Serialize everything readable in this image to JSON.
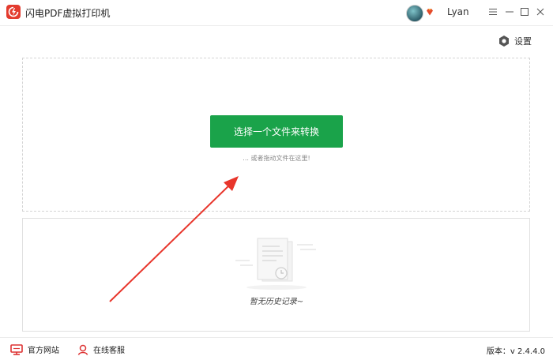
{
  "app": {
    "title": "闪电PDF虚拟打印机"
  },
  "user": {
    "name": "Lyan"
  },
  "settings": {
    "label": "设置"
  },
  "main": {
    "select_button": "选择一个文件来转换",
    "drag_hint": "... 或者拖动文件在这里!",
    "empty_history": "暂无历史记录~"
  },
  "footer": {
    "website": "官方网站",
    "support": "在线客服",
    "version": "版本：v 2.4.4.0"
  },
  "colors": {
    "accent_green": "#1aa34a",
    "brand_red": "#e33b2e",
    "arrow_red": "#e8352b"
  },
  "icons": [
    "app-logo-icon",
    "vip-diamond-icon",
    "menu-icon",
    "minimize-icon",
    "maximize-icon",
    "close-icon",
    "gear-icon",
    "monitor-icon",
    "person-icon"
  ]
}
